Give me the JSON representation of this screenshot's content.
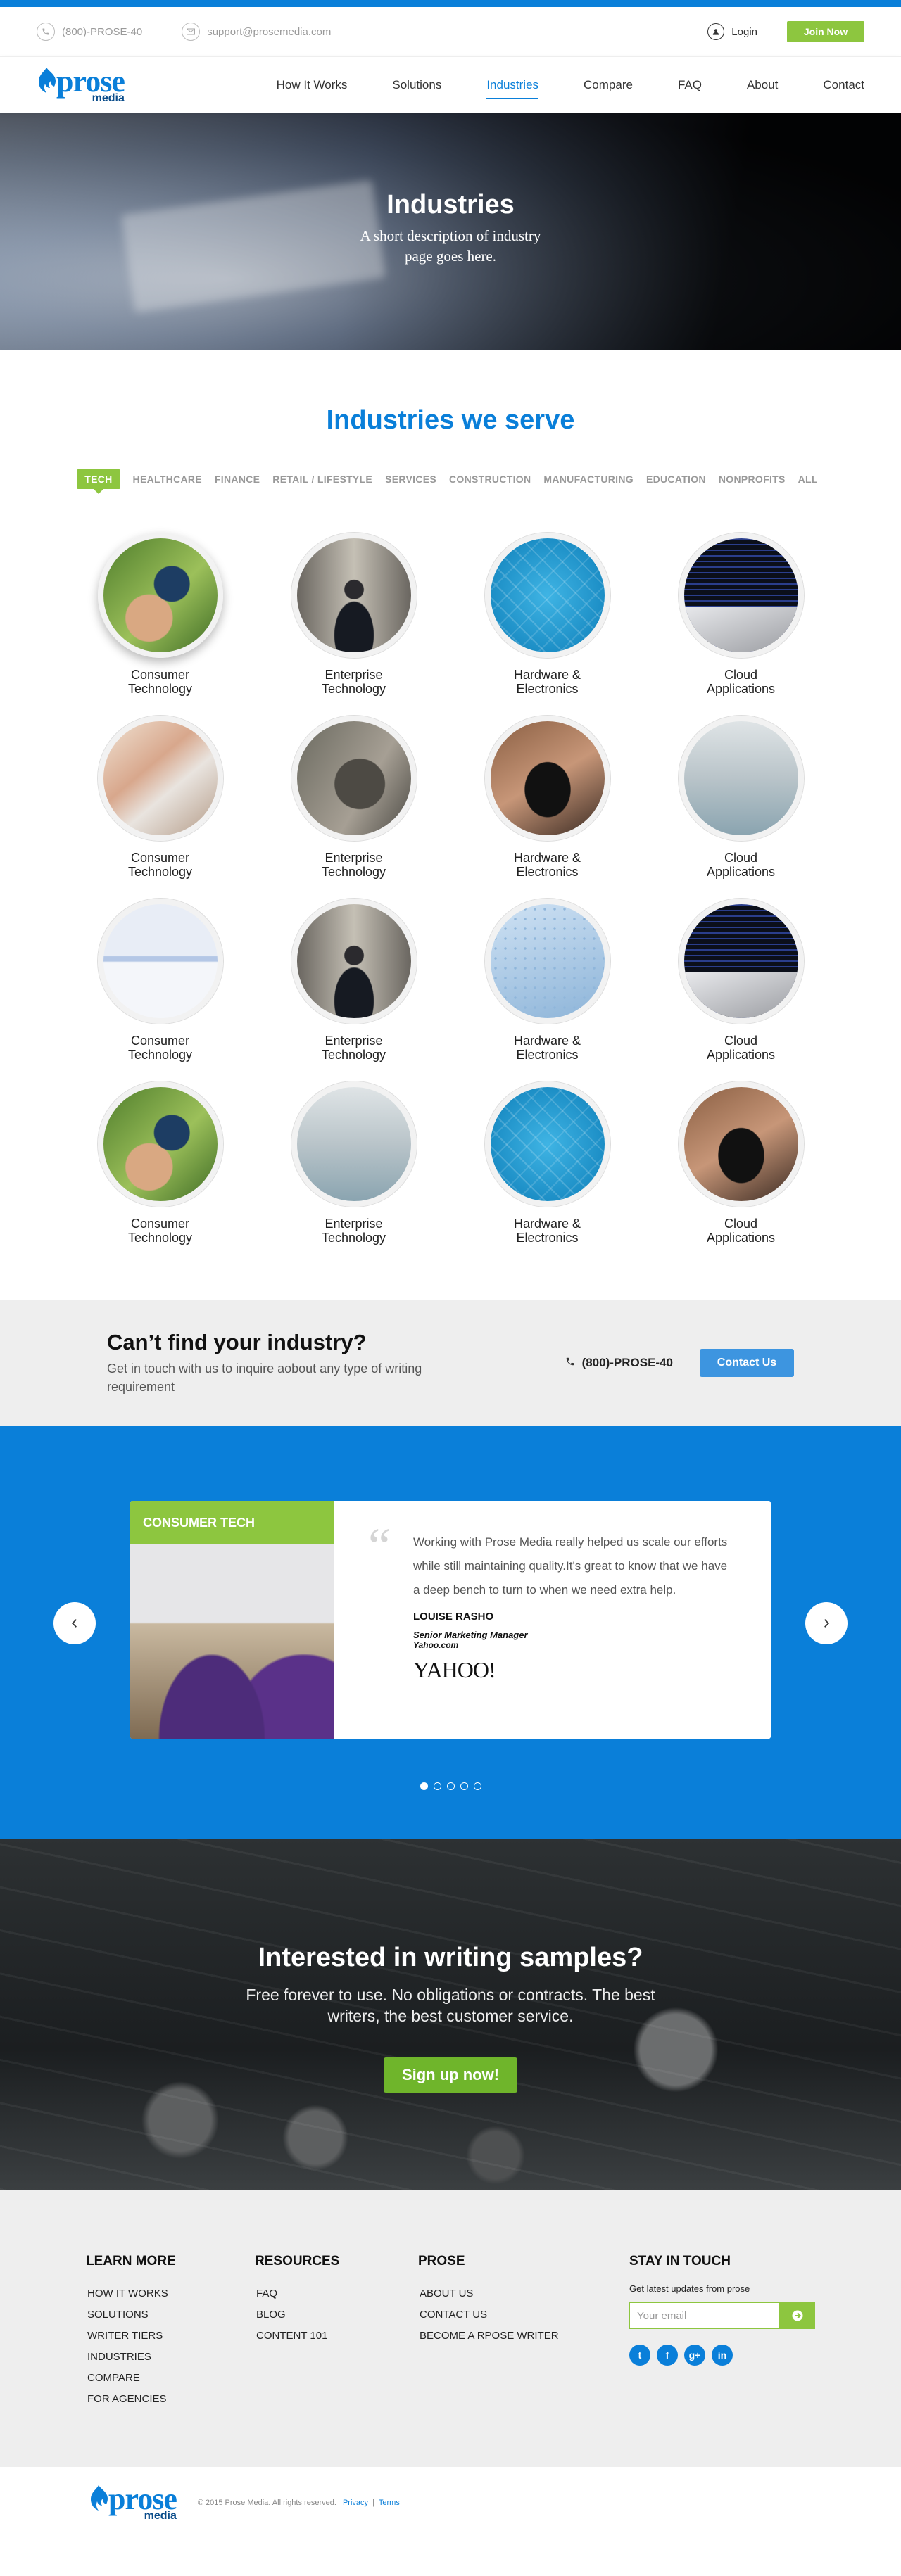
{
  "topbar": {
    "phone": "(800)-PROSE-40",
    "email": "support@prosemedia.com",
    "login": "Login",
    "join": "Join Now"
  },
  "logo": {
    "word": "prose",
    "sub": "media"
  },
  "nav": [
    "How It Works",
    "Solutions",
    "Industries",
    "Compare",
    "FAQ",
    "About",
    "Contact"
  ],
  "nav_active": "Industries",
  "hero": {
    "title": "Industries",
    "subtitle": "A short description of industry page goes here."
  },
  "industries": {
    "heading": "Industries we serve",
    "tabs": [
      "TECH",
      "HEALTHCARE",
      "FINANCE",
      "RETAIL / LIFESTYLE",
      "SERVICES",
      "CONSTRUCTION",
      "MANUFACTURING",
      "EDUCATION",
      "NONPROFITS",
      "ALL"
    ],
    "active_tab": "TECH",
    "items": [
      {
        "label": "Consumer Technology",
        "image": "hand-phone"
      },
      {
        "label": "Enterprise Technology",
        "image": "businessman"
      },
      {
        "label": "Hardware & Electronics",
        "image": "circuit-board"
      },
      {
        "label": "Cloud Applications",
        "image": "laptop-code"
      },
      {
        "label": "Consumer Technology",
        "image": "tablet-typing"
      },
      {
        "label": "Enterprise Technology",
        "image": "phone-in-hand"
      },
      {
        "label": "Hardware & Electronics",
        "image": "game-controller"
      },
      {
        "label": "Cloud Applications",
        "image": "hospital"
      },
      {
        "label": "Consumer Technology",
        "image": "paper-document"
      },
      {
        "label": "Enterprise Technology",
        "image": "businessman"
      },
      {
        "label": "Hardware & Electronics",
        "image": "dotted-keyboard"
      },
      {
        "label": "Cloud Applications",
        "image": "laptop-code"
      },
      {
        "label": "Consumer Technology",
        "image": "hand-phone"
      },
      {
        "label": "Enterprise Technology",
        "image": "hospital"
      },
      {
        "label": "Hardware & Electronics",
        "image": "circuit-board"
      },
      {
        "label": "Cloud Applications",
        "image": "game-controller"
      }
    ]
  },
  "cta": {
    "title": "Can’t find your industry?",
    "text": "Get in touch with us to inquire aobout any type of writing requirement",
    "phone": "(800)-PROSE-40",
    "button": "Contact Us"
  },
  "testimonial": {
    "tag": "CONSUMER TECH",
    "quote": "Working with Prose Media really helped us scale our efforts while still maintaining quality.It's great to know that we  have a deep bench to turn to when we need extra help.",
    "name": "LOUISE RASHO",
    "role": "Senior Marketing Manager",
    "company": "Yahoo.com",
    "logo_text": "YAHOO!",
    "slides": 5,
    "active_slide": 1
  },
  "samples": {
    "title": "Interested in writing samples?",
    "text": "Free forever to use. No obligations or contracts. The best writers, the best customer service.",
    "button": "Sign up now!"
  },
  "footer": {
    "learn_more": {
      "title": "LEARN MORE",
      "links": [
        "HOW IT WORKS",
        "SOLUTIONS",
        "WRITER TIERS",
        "INDUSTRIES",
        "COMPARE",
        "FOR AGENCIES"
      ]
    },
    "resources": {
      "title": "RESOURCES",
      "links": [
        "FAQ",
        "BLOG",
        "CONTENT 101"
      ]
    },
    "prose": {
      "title": "PROSE",
      "links": [
        "ABOUT US",
        "CONTACT US",
        "BECOME A RPOSE WRITER"
      ]
    },
    "stay": {
      "title": "STAY IN TOUCH",
      "sub": "Get latest updates from prose",
      "placeholder": "Your email",
      "social": [
        "twitter-icon",
        "facebook-icon",
        "google-plus-icon",
        "linkedin-icon"
      ]
    }
  },
  "bottom": {
    "copyright": "© 2015 Prose Media. All rights reserved.",
    "privacy": "Privacy",
    "separator": "|",
    "terms": "Terms"
  },
  "colors": {
    "brand_blue": "#0a7fd9",
    "accent_green": "#8dc63f"
  }
}
